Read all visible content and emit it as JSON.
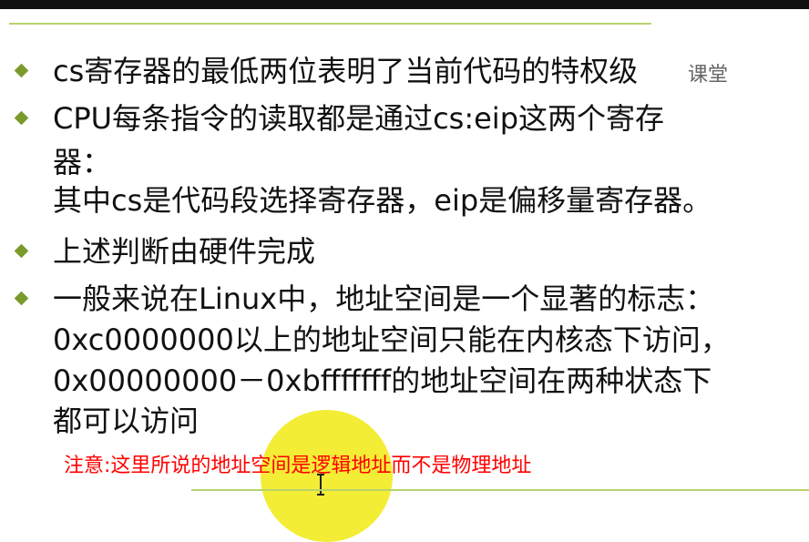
{
  "watermark": "课堂",
  "bullets": [
    {
      "lines": [
        "cs寄存器的最低两位表明了当前代码的特权级"
      ]
    },
    {
      "lines": [
        "CPU每条指令的读取都是通过cs:eip这两个寄存",
        "器：",
        "其中cs是代码段选择寄存器，eip是偏移量寄存器。"
      ]
    },
    {
      "lines": [
        "上述判断由硬件完成"
      ]
    },
    {
      "lines": [
        "一般来说在Linux中，地址空间是一个显著的标志：",
        "0xc0000000以上的地址空间只能在内核态下访问，",
        "0x00000000－0xbfffffff的地址空间在两种状态下",
        "都可以访问"
      ]
    }
  ],
  "note": "注意:这里所说的地址空间是逻辑地址而不是物理地址",
  "colors": {
    "bullet": "#7a9a2c",
    "rule": "#b7d36b",
    "note": "#ff0000",
    "highlight": "#f2ec2a"
  }
}
